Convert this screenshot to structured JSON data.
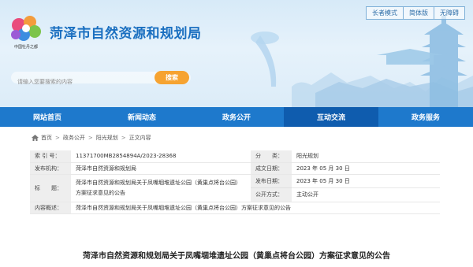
{
  "header": {
    "site_title": "菏泽市自然资源和规划局",
    "logo_caption": "中国牡丹之都",
    "top_links": [
      "长者模式",
      "简体版",
      "无障碍"
    ],
    "search": {
      "placeholder": "请输入您要搜索的内容",
      "button": "搜索"
    }
  },
  "nav": {
    "items": [
      "网站首页",
      "新闻动态",
      "政务公开",
      "互动交流",
      "政务服务"
    ],
    "active_index": 3
  },
  "breadcrumb": {
    "items": [
      "首页",
      "政务公开",
      "阳光规划",
      "正文内容"
    ]
  },
  "info_table": {
    "index_label": "索 引 号：",
    "index_value": "11371700MB2854894A/2023-28368",
    "category_label": "分　　类：",
    "category_value": "阳光规划",
    "issuer_label": "发布机构：",
    "issuer_value": "菏泽市自然资源和规划局",
    "created_label": "成文日期：",
    "created_value": "2023 年 05 月 30 日",
    "title_label": "标　　题：",
    "title_value": "菏泽市自然资源和规划局关于凤嘴堌堆遗址公园（黄巢点将台公园）方案征求意见的公告",
    "published_label": "发布日期：",
    "published_value": "2023 年 05 月 30 日",
    "open_label": "公开方式：",
    "open_value": "主动公开",
    "summary_label": "内容概述：",
    "summary_value": "菏泽市自然资源和规划局关于凤嘴堌堆遗址公园（黄巢点将台公园）方案征求意见的公告"
  },
  "article": {
    "title": "菏泽市自然资源和规划局关于凤嘴堌堆遗址公园（黄巢点将台公园）方案征求意见的公告"
  },
  "colors": {
    "brand_blue": "#1e79cc",
    "nav_active": "#0f5cae",
    "search_button": "#f6a331",
    "header_bg": "#dcecf8"
  },
  "icons": {
    "home": "home-icon"
  }
}
